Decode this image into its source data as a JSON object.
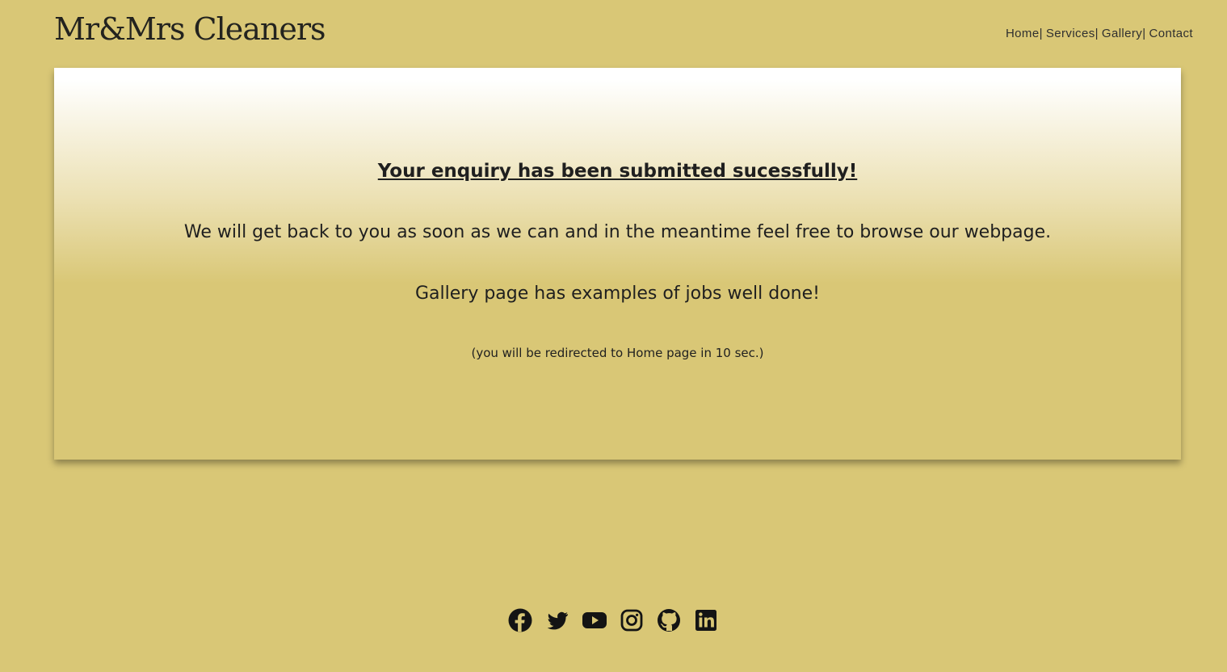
{
  "header": {
    "brand": "Mr&Mrs Cleaners",
    "nav": [
      {
        "label": "Home"
      },
      {
        "label": "Services"
      },
      {
        "label": "Gallery"
      },
      {
        "label": "Contact"
      }
    ],
    "separator": "|"
  },
  "message": {
    "title": "Your enquiry has been submitted sucessfully!",
    "body": "We will get back to you as soon as we can and in the meantime feel free to browse our webpage.",
    "gallery": "Gallery page has examples of jobs well done!",
    "redirect": "(you will be redirected to Home page in 10 sec.)"
  },
  "footer": {
    "socials": [
      {
        "icon": "facebook-icon"
      },
      {
        "icon": "twitter-icon"
      },
      {
        "icon": "youtube-icon"
      },
      {
        "icon": "instagram-icon"
      },
      {
        "icon": "github-icon"
      },
      {
        "icon": "linkedin-icon"
      }
    ]
  },
  "colors": {
    "background": "#d9c776",
    "text": "#1f1f1f",
    "card_top": "#ffffff"
  }
}
